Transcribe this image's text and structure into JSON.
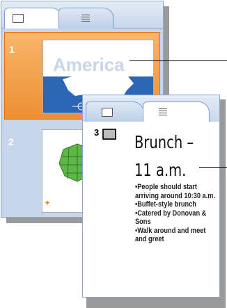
{
  "back_panel": {
    "tabs": [
      {
        "icon": "slides-icon",
        "active": true
      },
      {
        "icon": "outline-icon",
        "active": false
      }
    ],
    "thumbnails": [
      {
        "number": "1",
        "title": "America",
        "selected": true
      },
      {
        "number": "2",
        "selected": false
      }
    ]
  },
  "front_panel": {
    "tabs": [
      {
        "icon": "slides-icon",
        "active": false
      },
      {
        "icon": "outline-icon",
        "active": true
      }
    ],
    "slide": {
      "number": "3",
      "title": "Brunch – 11 a.m.",
      "bullets": [
        "•People should start arriving around 10:30 a.m.",
        "•Buffet-style brunch",
        "•Catered by Donovan & Sons",
        "•Walk around and meet and greet"
      ]
    }
  },
  "colors": {
    "selection": "#ee8f34",
    "pane_background": "#c7d6ea",
    "thumbnail_blue": "#2b66b4"
  }
}
